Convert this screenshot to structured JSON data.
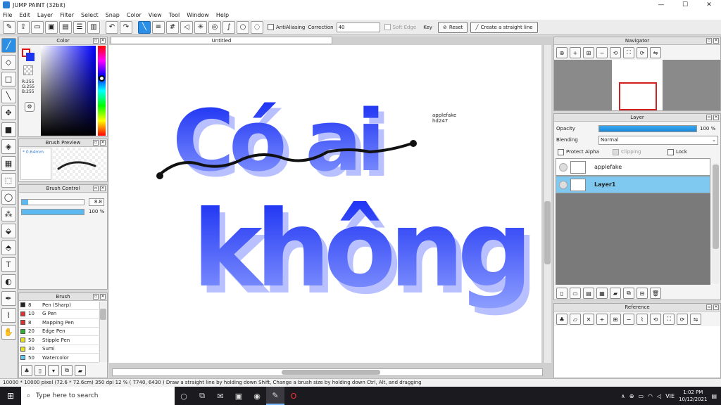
{
  "window": {
    "title": "JUMP PAINT (32bit)"
  },
  "menu": [
    "File",
    "Edit",
    "Layer",
    "Filter",
    "Select",
    "Snap",
    "Color",
    "View",
    "Tool",
    "Window",
    "Help"
  ],
  "toolbar": {
    "antialiasing_label": "AntiAliasing",
    "correction_label": "Correction",
    "correction_value": "40",
    "soft_edge_label": "Soft Edge",
    "key_label": "Key",
    "reset_label": "Reset",
    "straight_line_label": "Create a straight line"
  },
  "document": {
    "tab_title": "Untitled",
    "annotation_line1": "applefake",
    "annotation_line2": "hd247"
  },
  "color_panel": {
    "title": "Color",
    "r": "R:255",
    "g": "G:255",
    "b": "B:255"
  },
  "brush_preview": {
    "title": "Brush Preview",
    "size": "* 0.64mm"
  },
  "brush_control": {
    "title": "Brush Control",
    "size_value": "8.8",
    "opacity_value": "100 %",
    "size_fill": 0.1,
    "opacity_fill": 1.0
  },
  "brush_list": {
    "title": "Brush",
    "items": [
      {
        "num": "8",
        "name": "Pen (Sharp)",
        "color": "#222222"
      },
      {
        "num": "10",
        "name": "G Pen",
        "color": "#e03030"
      },
      {
        "num": "8",
        "name": "Mapping Pen",
        "color": "#e03030"
      },
      {
        "num": "20",
        "name": "Edge Pen",
        "color": "#30b030"
      },
      {
        "num": "50",
        "name": "Stipple Pen",
        "color": "#e8e020"
      },
      {
        "num": "30",
        "name": "Sumi",
        "color": "#e8e020"
      },
      {
        "num": "50",
        "name": "Watercolor",
        "color": "#60c8f0"
      }
    ]
  },
  "navigator": {
    "title": "Navigator"
  },
  "layer_panel": {
    "title": "Layer",
    "opacity_label": "Opacity",
    "opacity_value": "100 %",
    "opacity_fill": 1.0,
    "blending_label": "Blending",
    "blending_value": "Normal",
    "protect_alpha_label": "Protect Alpha",
    "clipping_label": "Clipping",
    "lock_label": "Lock",
    "layers": [
      {
        "name": "applefake",
        "selected": false
      },
      {
        "name": "Layer1",
        "selected": true
      }
    ]
  },
  "reference": {
    "title": "Reference"
  },
  "status": {
    "text": "10000 * 10000 pixel  (72.6 * 72.6cm)  350 dpi  12 %  ( 7740, 6430 )  Draw a straight line by holding down Shift, Change a brush size by holding down Ctrl, Alt, and dragging"
  },
  "taskbar": {
    "search_placeholder": "Type here to search",
    "time": "1:02 PM",
    "date": "10/12/2021",
    "lang": "VIE"
  },
  "artwork": {
    "line1": "Có ai",
    "line2": "không"
  },
  "colors": {
    "accent": "#2c8fe6",
    "art_blue": "#1d34f0",
    "art_light": "#a8b4ff"
  }
}
